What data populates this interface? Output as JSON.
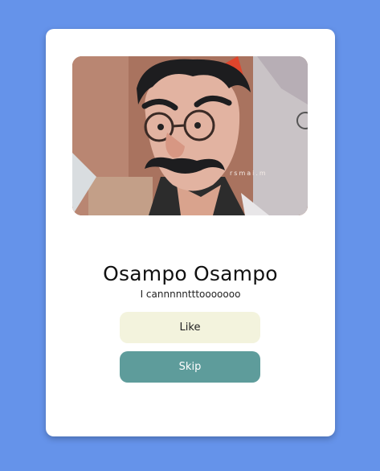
{
  "profile": {
    "name": "Osampo Osampo",
    "bio": "I cannnnntttooooooo",
    "photo_watermark": "rsmai.m"
  },
  "actions": {
    "like_label": "Like",
    "skip_label": "Skip"
  },
  "colors": {
    "background": "#6593ea",
    "card": "#ffffff",
    "like_button": "#f3f3dd",
    "skip_button": "#5e9c9b"
  }
}
